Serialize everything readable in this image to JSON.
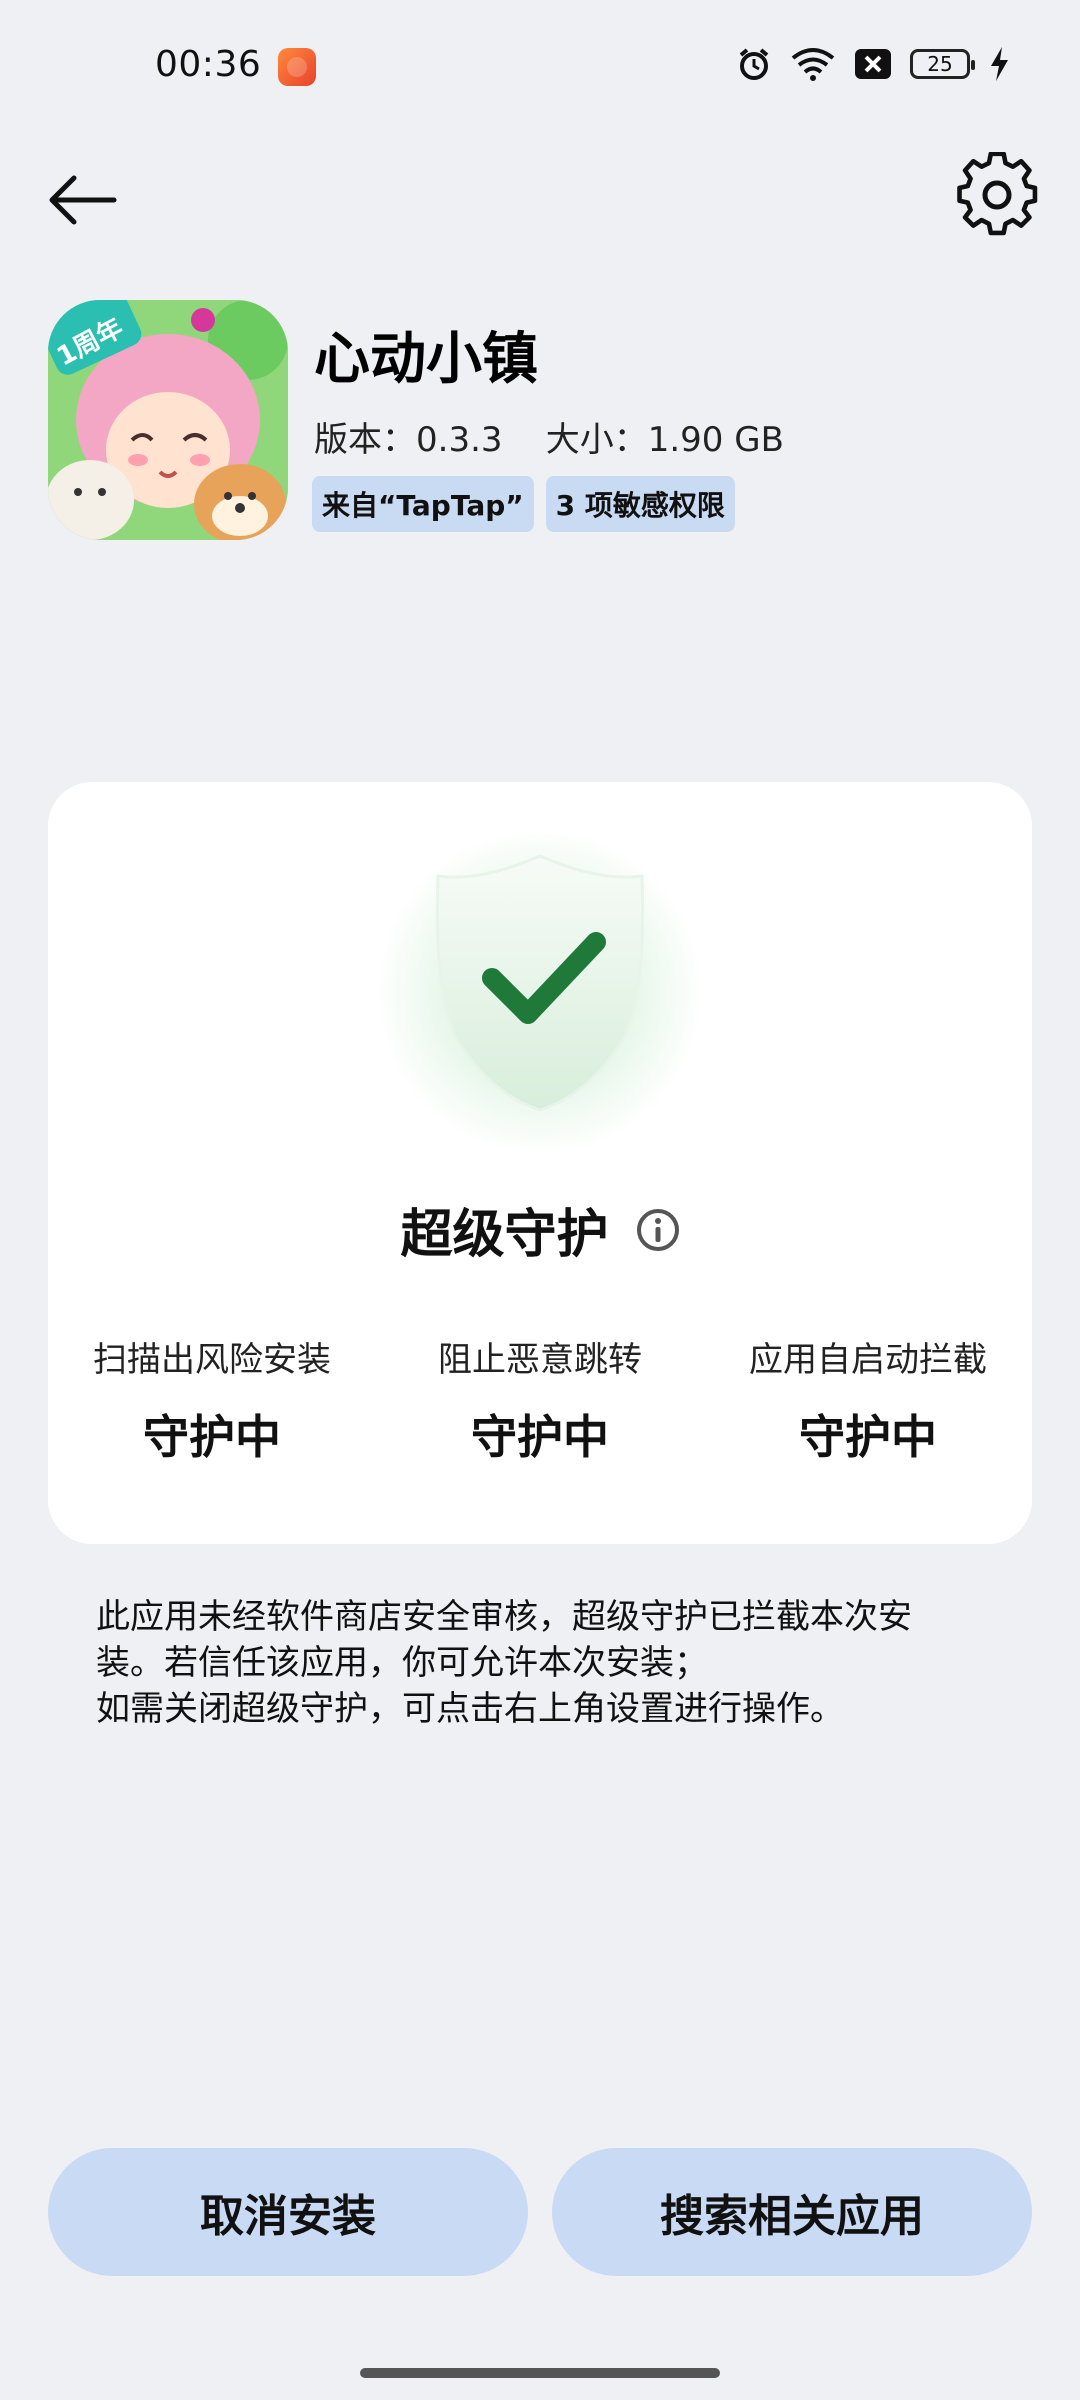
{
  "status_bar": {
    "time": "00:36",
    "battery_level": "25",
    "icons": [
      "app-notification-icon",
      "alarm-icon",
      "wifi-icon",
      "sim-disabled-icon",
      "battery-icon",
      "charging-icon"
    ]
  },
  "top_bar": {
    "back_icon": "arrow-left-icon",
    "settings_icon": "gear-icon"
  },
  "app": {
    "name": "心动小镇",
    "meta": "版本：0.3.3    大小：1.90 GB",
    "icon_badge": "1周年",
    "tags": [
      "来自“TapTap”",
      "3 项敏感权限"
    ]
  },
  "protection": {
    "title": "超级守护",
    "features": [
      {
        "label": "扫描出风险安装",
        "status": "守护中"
      },
      {
        "label": "阻止恶意跳转",
        "status": "守护中"
      },
      {
        "label": "应用自启动拦截",
        "status": "守护中"
      }
    ]
  },
  "notice": {
    "line1": "此应用未经软件商店安全审核，超级守护已拦截本次安",
    "line2": "装。若信任该应用，你可允许本次安装；",
    "line3": "如需关闭超级守护，可点击右上角设置进行操作。"
  },
  "actions": {
    "cancel_label": "取消安装",
    "search_label": "搜索相关应用"
  },
  "colors": {
    "background": "#eff0f3",
    "button": "#c9daf5",
    "tag": "#c9daf3",
    "check": "#1f7a3a"
  }
}
